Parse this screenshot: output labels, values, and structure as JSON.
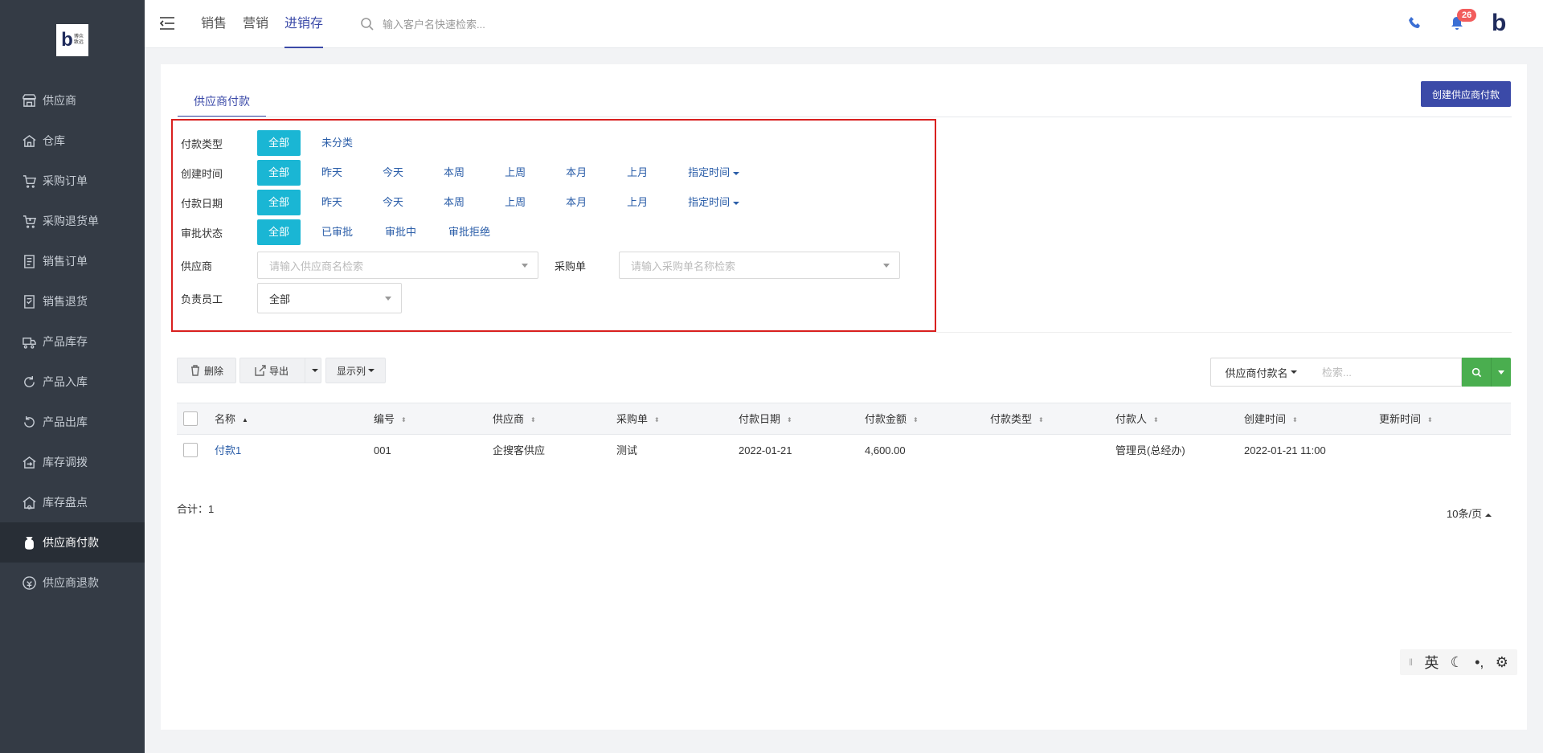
{
  "sidebar": {
    "logo": {
      "mark": "b",
      "small_line1": "博众",
      "small_line2": "致远"
    },
    "items": [
      {
        "label": "供应商",
        "icon": "store-icon"
      },
      {
        "label": "仓库",
        "icon": "warehouse-icon"
      },
      {
        "label": "采购订单",
        "icon": "cart-icon"
      },
      {
        "label": "采购退货单",
        "icon": "cart-return-icon"
      },
      {
        "label": "销售订单",
        "icon": "doc-icon"
      },
      {
        "label": "销售退货",
        "icon": "doc-return-icon"
      },
      {
        "label": "产品库存",
        "icon": "truck-icon"
      },
      {
        "label": "产品入库",
        "icon": "inbound-icon"
      },
      {
        "label": "产品出库",
        "icon": "outbound-icon"
      },
      {
        "label": "库存调拨",
        "icon": "transfer-icon"
      },
      {
        "label": "库存盘点",
        "icon": "inventory-check-icon"
      },
      {
        "label": "供应商付款",
        "icon": "money-bag-icon",
        "active": true
      },
      {
        "label": "供应商退款",
        "icon": "refund-icon"
      }
    ]
  },
  "header": {
    "tabs": [
      "销售",
      "营销",
      "进销存"
    ],
    "active_tab": "进销存",
    "search_placeholder": "输入客户名快速检索...",
    "notification_count": "26",
    "brand_mark": "b"
  },
  "page": {
    "tab_label": "供应商付款",
    "create_button": "创建供应商付款"
  },
  "filters": {
    "pay_type": {
      "label": "付款类型",
      "options": [
        "全部",
        "未分类"
      ]
    },
    "created": {
      "label": "创建时间",
      "options": [
        "全部",
        "昨天",
        "今天",
        "本周",
        "上周",
        "本月",
        "上月"
      ],
      "custom": "指定时间"
    },
    "pay_date": {
      "label": "付款日期",
      "options": [
        "全部",
        "昨天",
        "今天",
        "本周",
        "上周",
        "本月",
        "上月"
      ],
      "custom": "指定时间"
    },
    "approval": {
      "label": "审批状态",
      "options": [
        "全部",
        "已审批",
        "审批中",
        "审批拒绝"
      ]
    },
    "supplier": {
      "label": "供应商",
      "placeholder": "请输入供应商名检索"
    },
    "purchase_order": {
      "label": "采购单",
      "placeholder": "请输入采购单名称检索"
    },
    "owner": {
      "label": "负责员工",
      "value": "全部"
    }
  },
  "toolbar": {
    "delete": "删除",
    "export": "导出",
    "columns": "显示列",
    "search_field": "供应商付款名",
    "search_placeholder": "检索..."
  },
  "table": {
    "headers": [
      "名称",
      "编号",
      "供应商",
      "采购单",
      "付款日期",
      "付款金额",
      "付款类型",
      "付款人",
      "创建时间",
      "更新时间"
    ],
    "rows": [
      [
        "付款1",
        "001",
        "企搜客供应",
        "测试",
        "2022-01-21",
        "4,600.00",
        "",
        "管理员(总经办)",
        "2022-01-21 11:00",
        ""
      ]
    ]
  },
  "footer": {
    "total": "合计：1",
    "page_size": "10条/页"
  },
  "ime": [
    "英",
    "☾",
    "•,",
    "⚙"
  ],
  "colors": {
    "accent": "#3b4aa8",
    "filter_active": "#1ab6d4",
    "search_green": "#4aae4f",
    "highlight_border": "#d9201f",
    "sidebar_bg": "#343b45"
  }
}
